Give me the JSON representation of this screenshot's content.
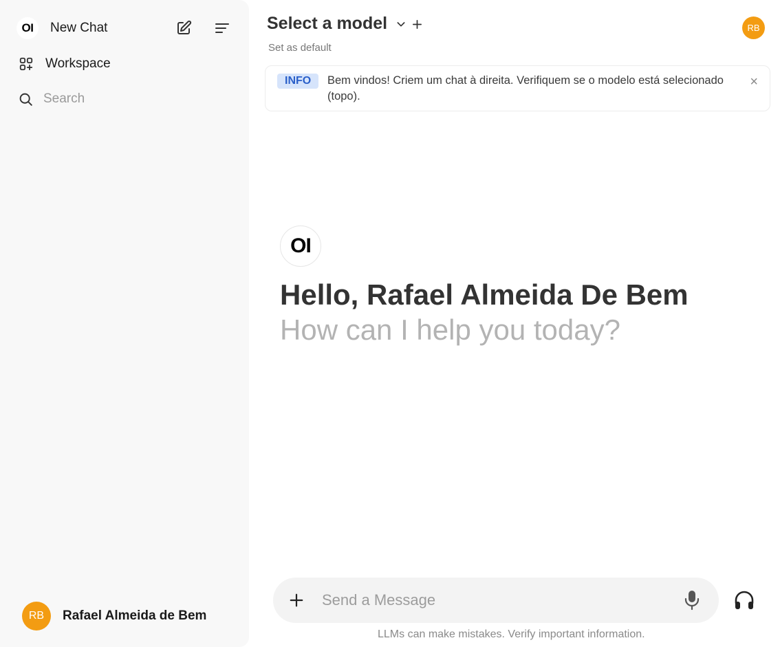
{
  "sidebar": {
    "logo_text": "OI",
    "new_chat_label": "New Chat",
    "workspace_label": "Workspace",
    "search_placeholder": "Search",
    "user": {
      "initials": "RB",
      "name": "Rafael Almeida de Bem"
    }
  },
  "icons": {
    "new_chat": "edit-icon",
    "menu": "menu-lines-icon",
    "workspace": "grid-plus-icon",
    "search": "search-icon",
    "model_dropdown": "chevron-down-icon",
    "add_model": "plus-icon",
    "close": "close-icon",
    "attach": "plus-icon",
    "voice": "microphone-icon",
    "call": "headphones-icon"
  },
  "header": {
    "model_selector_label": "Select a model",
    "set_default_label": "Set as default",
    "user_initials": "RB"
  },
  "banner": {
    "badge": "INFO",
    "text": "Bem vindos! Criem um chat à direita. Verifiquem se o modelo está selecionado (topo).",
    "close_glyph": "×"
  },
  "hero": {
    "logo_text": "OI",
    "greeting": "Hello, Rafael Almeida De Bem",
    "subtitle": "How can I help you today?"
  },
  "composer": {
    "placeholder": "Send a Message",
    "disclaimer": "LLMs can make mistakes. Verify important information."
  },
  "colors": {
    "avatar": "#f39c12",
    "sidebar_bg": "#f8f8f8",
    "badge_bg": "#d6e4fb",
    "badge_text": "#2a5fc9"
  }
}
